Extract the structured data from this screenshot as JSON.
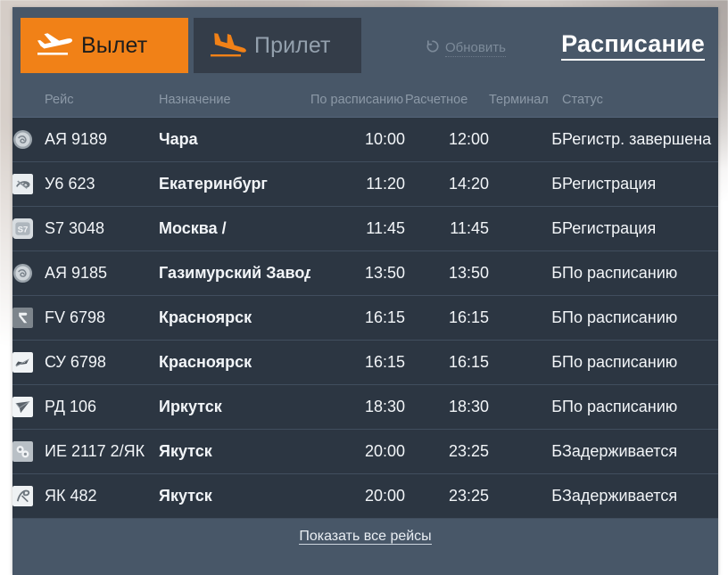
{
  "panel": {
    "accent_color": "#f18117",
    "panel_bg": "#485768",
    "row_bg": "#2c3642",
    "delayed_color": "#e9cb52"
  },
  "toolbar": {
    "departure_tab": {
      "label": "Вылет",
      "icon": "plane-takeoff-icon",
      "active": true
    },
    "arrival_tab": {
      "label": "Прилет",
      "icon": "plane-landing-icon",
      "active": false
    },
    "refresh": {
      "label": "Обновить",
      "icon": "refresh-icon"
    },
    "schedule_link": {
      "label": "Расписание"
    }
  },
  "table": {
    "columns": [
      {
        "key": "logo",
        "label": ""
      },
      {
        "key": "num",
        "label": "Рейс"
      },
      {
        "key": "dest",
        "label": "Назначение"
      },
      {
        "key": "sched",
        "label": "По расписанию"
      },
      {
        "key": "est",
        "label": "Расчетное"
      },
      {
        "key": "term",
        "label": "Терминал"
      },
      {
        "key": "stat",
        "label": "Статус"
      }
    ],
    "rows": [
      {
        "logo": "airline-logo-angara",
        "num": "АЯ 9189",
        "dest": "Чара",
        "sched": "10:00",
        "est": "12:00",
        "term": "Б",
        "stat": "Регистр. завершена",
        "delayed": false
      },
      {
        "logo": "airline-logo-ural",
        "num": "У6 623",
        "dest": "Екатеринбург",
        "sched": "11:20",
        "est": "14:20",
        "term": "Б",
        "stat": "Регистрация",
        "delayed": false
      },
      {
        "logo": "airline-logo-s7",
        "num": "S7 3048",
        "dest": "Москва /",
        "sched": "11:45",
        "est": "11:45",
        "term": "Б",
        "stat": "Регистрация",
        "delayed": false
      },
      {
        "logo": "airline-logo-angara",
        "num": "АЯ 9185",
        "dest": "Газимурский Завод",
        "sched": "13:50",
        "est": "13:50",
        "term": "Б",
        "stat": "По расписанию",
        "delayed": false
      },
      {
        "logo": "airline-logo-rossiya",
        "num": "FV 6798",
        "dest": "Красноярск",
        "sched": "16:15",
        "est": "16:15",
        "term": "Б",
        "stat": "По расписанию",
        "delayed": false
      },
      {
        "logo": "airline-logo-aeroflot",
        "num": "СУ 6798",
        "dest": "Красноярск",
        "sched": "16:15",
        "est": "16:15",
        "term": "Б",
        "stat": "По расписанию",
        "delayed": false
      },
      {
        "logo": "airline-logo-alrosa",
        "num": "РД 106",
        "dest": "Иркутск",
        "sched": "18:30",
        "est": "18:30",
        "term": "Б",
        "stat": "По расписанию",
        "delayed": false
      },
      {
        "logo": "airline-logo-izhavia",
        "num": "ИЕ 2117 2/ЯК",
        "dest": "Якутск",
        "sched": "20:00",
        "est": "23:25",
        "term": "Б",
        "stat": "Задерживается",
        "delayed": true
      },
      {
        "logo": "airline-logo-yakutia",
        "num": "ЯК 482",
        "dest": "Якутск",
        "sched": "20:00",
        "est": "23:25",
        "term": "Б",
        "stat": "Задерживается",
        "delayed": true
      }
    ]
  },
  "footer": {
    "show_all_label": "Показать все рейсы"
  }
}
